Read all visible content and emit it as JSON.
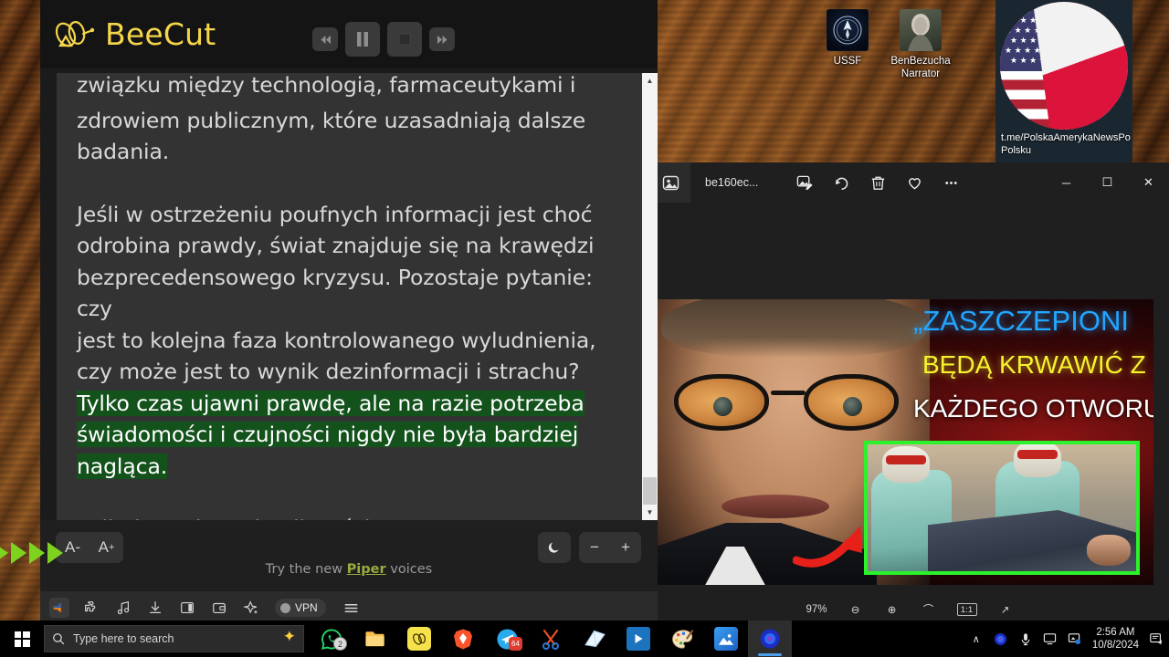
{
  "desktop": {
    "icons": [
      {
        "label": "USSF",
        "icon": "ussf-shield-icon"
      },
      {
        "label": "BenBezucha\nNarrator",
        "label_line1": "BenBezucha",
        "label_line2": "Narrator",
        "icon": "narrator-portrait-icon"
      }
    ]
  },
  "telegram_card": {
    "caption_line1": "t.me/PolskaAmerykaNewsPo",
    "caption_line2": "Polsku",
    "flag": "us-poland-flag-icon"
  },
  "reader": {
    "brand": "BeeCut",
    "brand_color": "#f5d64a",
    "transport": {
      "rewind": "◂◂",
      "pause": "pause-icon",
      "stop": "stop-icon",
      "forward": "▸▸"
    },
    "text": {
      "p1_line1": "związku między technologią, farmaceutykami i",
      "p1_line2": "zdrowiem publicznym, które uzasadniają dalsze",
      "p1_line3": "badania.",
      "p2_line1": "Jeśli w ostrzeżeniu poufnych informacji jest choć",
      "p2_line2": "odrobina prawdy, świat znajduje się na krawędzi",
      "p2_line3": "bezprecedensowego kryzysu. Pozostaje pytanie: czy",
      "p2_line4": "jest to kolejna faza kontrolowanego wyludnienia,",
      "p2_line5": "czy może jest to wynik dezinformacji i strachu?",
      "hl_line1": "Tylko czas ujawni prawdę, ale na razie potrzeba",
      "hl_line2": "świadomości i czujności nigdy nie była bardziej",
      "hl_line3": "nagląca.",
      "p3": "Polityka redystrybucji treści.",
      "highlight_color": "#14521c"
    },
    "footer": {
      "font_smaller": "A-",
      "font_larger_a": "A",
      "font_larger_sup": "+",
      "theme_toggle": "moon-icon",
      "zoom_out": "−",
      "zoom_in": "+",
      "promo_prefix": "Try the new ",
      "promo_link": "Piper",
      "promo_suffix": " voices",
      "promo_link_color": "#9aac3c"
    }
  },
  "browser_toolbar": {
    "items": [
      {
        "name": "read-aloud-speaker-icon",
        "active": true
      },
      {
        "name": "extensions-puzzle-icon",
        "active": false
      },
      {
        "name": "music-note-icon",
        "active": false
      },
      {
        "name": "download-icon",
        "active": false
      },
      {
        "name": "sidebar-panel-icon",
        "active": false
      },
      {
        "name": "wallet-icon",
        "active": false
      },
      {
        "name": "leo-sparkle-icon",
        "active": false
      }
    ],
    "vpn_label": "VPN",
    "menu_icon": "hamburger-menu-icon"
  },
  "photos_window": {
    "title": "be160ec...",
    "app_icon": "photos-app-icon",
    "tools": [
      {
        "name": "edit-image-icon"
      },
      {
        "name": "rotate-icon"
      },
      {
        "name": "delete-trash-icon"
      },
      {
        "name": "favorite-heart-icon"
      },
      {
        "name": "more-options-icon"
      }
    ],
    "window_buttons": {
      "minimize": "─",
      "maximize": "☐",
      "close": "✕"
    },
    "zoom_level": "97%",
    "bottom_controls": [
      {
        "name": "zoom-out-icon",
        "glyph": "⊖"
      },
      {
        "name": "zoom-in-icon",
        "glyph": "⊕"
      },
      {
        "name": "fit-to-window-icon",
        "glyph": "⌒"
      },
      {
        "name": "actual-size-icon",
        "glyph": "1:1"
      },
      {
        "name": "fullscreen-icon",
        "glyph": "↗"
      }
    ],
    "image_content": {
      "line1": "„ZASZCZEPIONI",
      "line2": "BĘDĄ KRWAWIĆ Z",
      "line3": "KAŻDEGO OTWORU™",
      "line1_color": "#22a6ff",
      "line2_color": "#f6f32d",
      "line3_color": "#ffffff",
      "inset_border_color": "#2bf22b",
      "arrow_color": "#e8201a"
    }
  },
  "taskbar": {
    "start_icon": "windows-start-icon",
    "search_placeholder": "Type here to search",
    "search_sparkle_icon": "copilot-sparkle-icon",
    "apps": [
      {
        "name": "whatsapp",
        "badge": "2",
        "badge_style": "gray",
        "color": "#25d366",
        "glyph": "✆",
        "active": false
      },
      {
        "name": "file-explorer",
        "badge": "",
        "color": "#f7c04a",
        "glyph": "🗀",
        "active": false
      },
      {
        "name": "beecut",
        "badge": "",
        "color": "#f5e14a",
        "glyph": "B",
        "active": false
      },
      {
        "name": "brave",
        "badge": "",
        "color": "#fb542b",
        "glyph": "🦁",
        "active": false
      },
      {
        "name": "telegram",
        "badge": "64",
        "badge_style": "red",
        "color": "#2aabee",
        "glyph": "➤",
        "active": false
      },
      {
        "name": "snipping-tool",
        "badge": "",
        "color": "#e8501f",
        "glyph": "✂",
        "active": false
      },
      {
        "name": "sticky-notes",
        "badge": "",
        "color": "#cfe8f7",
        "glyph": "◧",
        "active": false
      },
      {
        "name": "movies-and-tv",
        "badge": "",
        "color": "#1b74bd",
        "glyph": "▶",
        "active": false
      },
      {
        "name": "paint",
        "badge": "",
        "color": "#f2d9a0",
        "glyph": "🎨",
        "active": false
      },
      {
        "name": "photos",
        "badge": "",
        "color": "#2b7cd3",
        "glyph": "⛰",
        "active": false
      },
      {
        "name": "read-aloud",
        "badge": "",
        "color": "#2b3fd1",
        "glyph": "◉",
        "active": true
      }
    ],
    "tray": {
      "chevron": "∧",
      "icons": [
        {
          "name": "read-aloud-tray-icon"
        },
        {
          "name": "microphone-icon"
        },
        {
          "name": "display-icon"
        },
        {
          "name": "network-icon"
        }
      ],
      "time": "2:56 AM",
      "date": "10/8/2024",
      "notifications_icon": "notifications-icon"
    }
  }
}
